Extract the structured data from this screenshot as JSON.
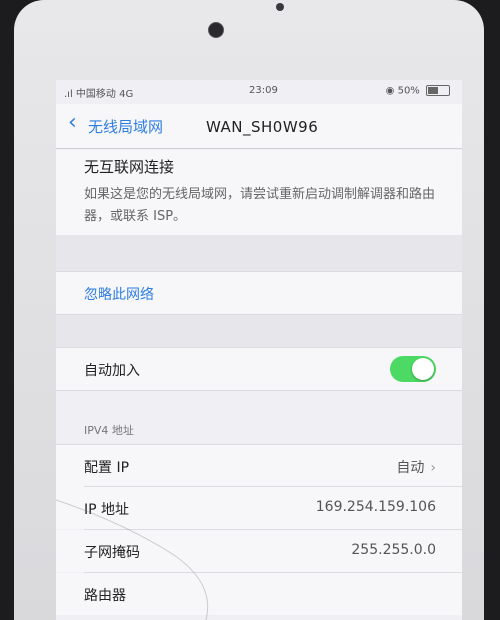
{
  "status_bar": {
    "carrier": ".ıl 中国移动  4G",
    "time": "23:09",
    "battery": "50%",
    "battery_level": 0.5
  },
  "nav": {
    "back_label": "无线局域网",
    "title": "WAN_SH0W96"
  },
  "warning": {
    "title": "无互联网连接",
    "body": "如果这是您的无线局域网，请尝试重新启动调制解调器和路由器，或联系 ISP。"
  },
  "forget": {
    "label": "忽略此网络"
  },
  "auto_join": {
    "label": "自动加入",
    "enabled": true
  },
  "ipv4": {
    "header": "IPV4 地址",
    "rows": [
      {
        "label": "配置 IP",
        "value": "自动"
      },
      {
        "label": "IP 地址",
        "value": "169.254.159.106"
      },
      {
        "label": "子网掩码",
        "value": "255.255.0.0"
      },
      {
        "label": "路由器",
        "value": ""
      }
    ]
  },
  "colors": {
    "accent": "#2f7de1",
    "toggle_on": "#4cd964"
  }
}
